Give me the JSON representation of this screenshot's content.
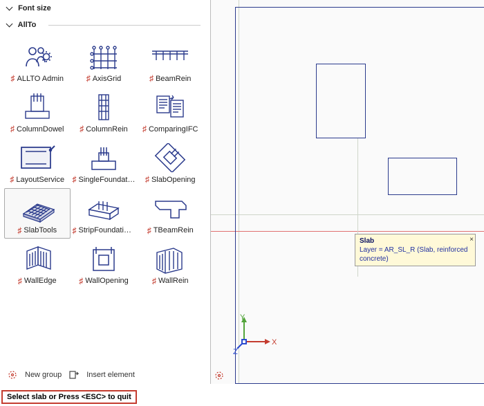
{
  "sections": {
    "fontSize": {
      "title": "Font size"
    },
    "allto": {
      "title": "AllTo"
    }
  },
  "tools": {
    "allto_admin": {
      "label": "ALLTO Admin"
    },
    "axis_grid": {
      "label": "AxisGrid"
    },
    "beam_rein": {
      "label": "BeamRein"
    },
    "column_dowel": {
      "label": "ColumnDowel"
    },
    "column_rein": {
      "label": "ColumnRein"
    },
    "comparing_ifc": {
      "label": "ComparingIFC"
    },
    "layout_service": {
      "label": "LayoutService"
    },
    "single_foundation": {
      "label": "SingleFoundation…"
    },
    "slab_opening": {
      "label": "SlabOpening"
    },
    "slab_tools": {
      "label": "SlabTools"
    },
    "strip_foundation": {
      "label": "StripFoundationR…"
    },
    "tbeam_rein": {
      "label": "TBeamRein"
    },
    "wall_edge": {
      "label": "WallEdge"
    },
    "wall_opening": {
      "label": "WallOpening"
    },
    "wall_rein": {
      "label": "WallRein"
    }
  },
  "footer": {
    "new_group": "New group",
    "insert_element": "Insert element"
  },
  "status": {
    "prompt": "Select slab or Press <ESC> to quit"
  },
  "tooltip": {
    "title": "Slab",
    "line": "Layer = AR_SL_R (Slab, reinforced concrete)"
  },
  "ucs": {
    "x": "X",
    "y": "Y",
    "z": "Z"
  },
  "colors": {
    "outline": "#2a3a8c",
    "red": "#c43c2f",
    "greenY": "#52a43a",
    "blueZ": "#2a4ad0"
  }
}
